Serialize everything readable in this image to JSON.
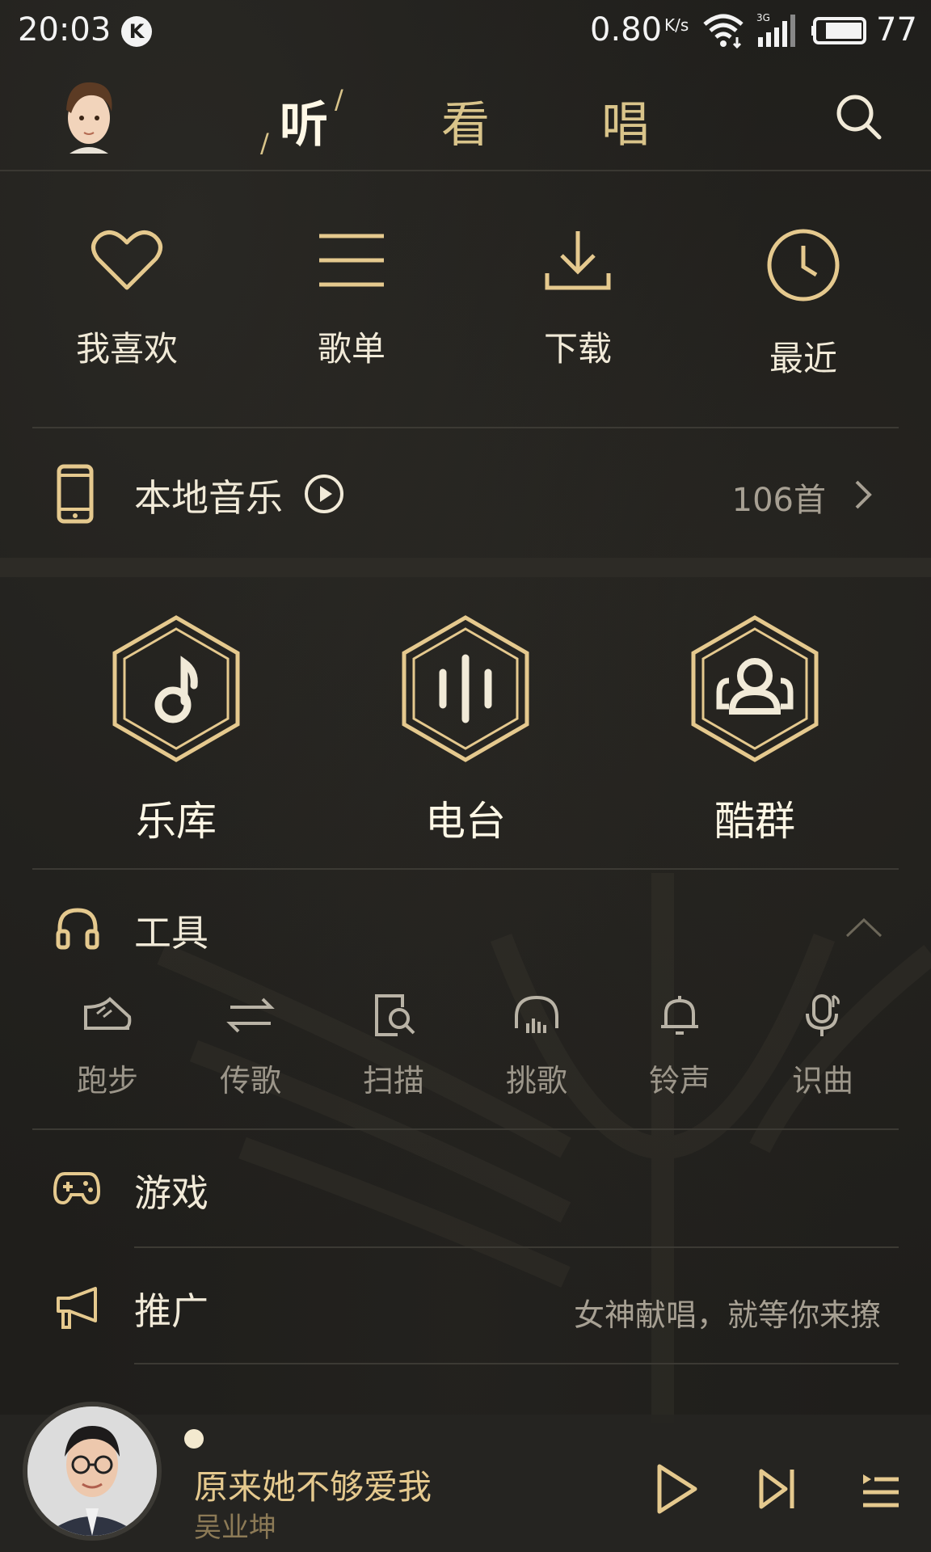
{
  "status_bar": {
    "time": "20:03",
    "carrier_icon": "K",
    "net_speed": "0.80",
    "net_speed_unit": "K/s",
    "network_type": "3G",
    "battery": "77"
  },
  "top_nav": {
    "tabs": [
      {
        "label": "听",
        "active": true
      },
      {
        "label": "看",
        "active": false
      },
      {
        "label": "唱",
        "active": false
      }
    ]
  },
  "quick_actions": [
    {
      "label": "我喜欢",
      "icon": "heart-icon"
    },
    {
      "label": "歌单",
      "icon": "menu-lines-icon"
    },
    {
      "label": "下载",
      "icon": "download-icon"
    },
    {
      "label": "最近",
      "icon": "clock-icon"
    }
  ],
  "local_music": {
    "label": "本地音乐",
    "count": "106首"
  },
  "hex_items": [
    {
      "label": "乐库",
      "icon": "music-note-icon"
    },
    {
      "label": "电台",
      "icon": "radio-bars-icon"
    },
    {
      "label": "酷群",
      "icon": "group-icon"
    }
  ],
  "tools": {
    "label": "工具",
    "items": [
      {
        "label": "跑步",
        "icon": "running-shoe-icon"
      },
      {
        "label": "传歌",
        "icon": "transfer-icon"
      },
      {
        "label": "扫描",
        "icon": "scan-icon"
      },
      {
        "label": "挑歌",
        "icon": "headphones-icon"
      },
      {
        "label": "铃声",
        "icon": "bell-icon"
      },
      {
        "label": "识曲",
        "icon": "mic-recognize-icon"
      }
    ]
  },
  "games": {
    "label": "游戏"
  },
  "promo": {
    "label": "推广",
    "text": "女神献唱，就等你来撩"
  },
  "player": {
    "song": "原来她不够爱我",
    "artist": "吴业坤"
  },
  "colors": {
    "accent": "#e5c98e",
    "background": "#1f1e1b"
  }
}
